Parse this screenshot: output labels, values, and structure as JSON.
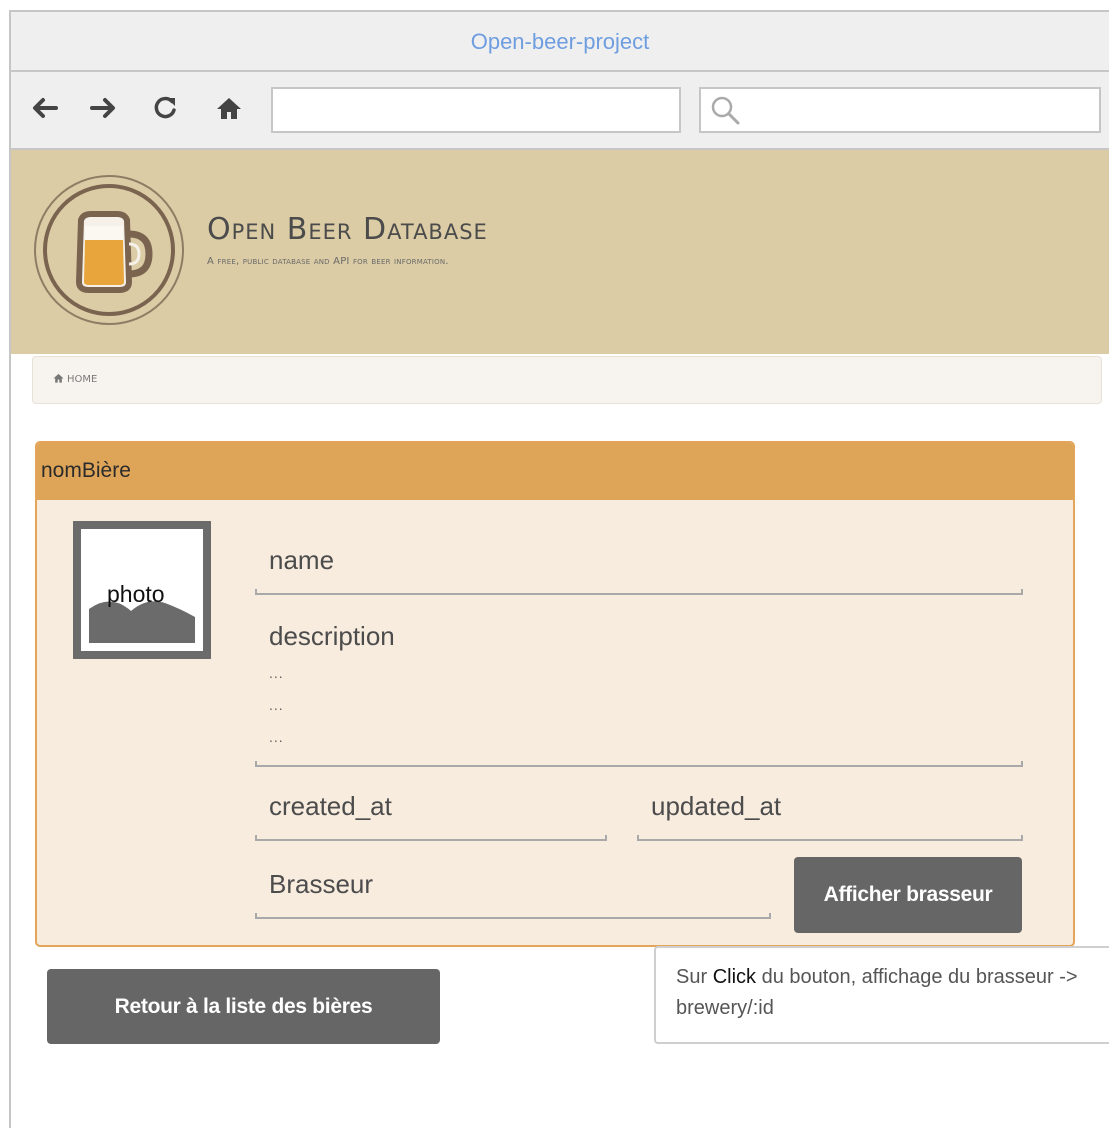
{
  "window": {
    "title": "Open-beer-project"
  },
  "nav": {
    "url_value": "",
    "search_value": ""
  },
  "brand": {
    "title": "Open Beer Database",
    "subtitle": "A free, public database and API for beer information."
  },
  "breadcrumb": {
    "home_label": "HOME"
  },
  "panel": {
    "title": "nomBière",
    "photo_label": "photo",
    "fields": {
      "name": "name",
      "description": "description",
      "description_lines": [
        "...",
        "...",
        "..."
      ],
      "created_at": "created_at",
      "updated_at": "updated_at",
      "brasseur": "Brasseur"
    },
    "show_brewer_button": "Afficher brasseur"
  },
  "back_button": "Retour à la liste des bières",
  "tooltip": {
    "before": "Sur ",
    "emphasis": "Click",
    "after": " du bouton, affichage du brasseur -> brewery/:id"
  },
  "colors": {
    "banner": "#dbcca5",
    "panel_header": "#dea558",
    "panel_body": "#f8ecdf",
    "button": "#666666",
    "title_link": "#6f9ee0"
  }
}
